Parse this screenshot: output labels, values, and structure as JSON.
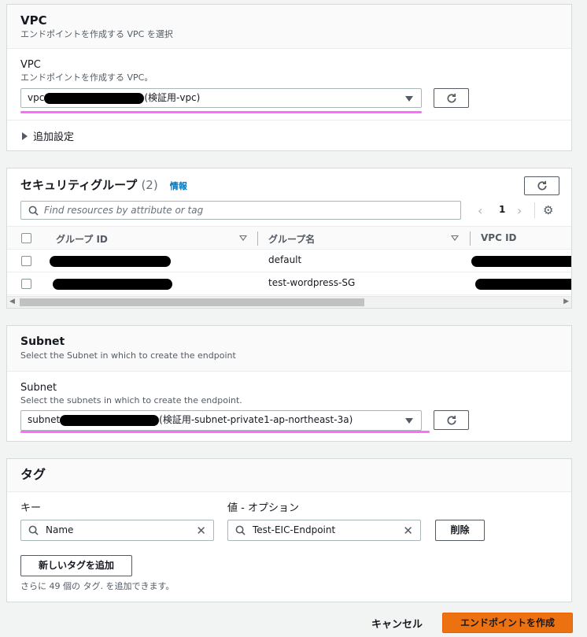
{
  "vpc_section": {
    "title": "VPC",
    "description": "エンドポイントを作成する VPC を選択",
    "field_label": "VPC",
    "field_desc": "エンドポイントを作成する VPC。",
    "select_prefix": "vpc",
    "select_suffix": "(検証用-vpc)",
    "additional_settings": "追加設定"
  },
  "sg_section": {
    "title": "セキュリティグループ",
    "count": "(2)",
    "info_link": "情報",
    "search_placeholder": "Find resources by attribute or tag",
    "page_number": "1",
    "columns": [
      "グループ ID",
      "グループ名",
      "VPC ID"
    ],
    "rows": [
      {
        "group_name": "default"
      },
      {
        "group_name": "test-wordpress-SG"
      }
    ]
  },
  "subnet_section": {
    "title": "Subnet",
    "description": "Select the Subnet in which to create the endpoint",
    "field_label": "Subnet",
    "field_desc": "Select the subnets in which to create the endpoint.",
    "select_prefix": "subnet",
    "select_suffix": "(検証用-subnet-private1-ap-northeast-3a)"
  },
  "tag_section": {
    "title": "タグ",
    "key_label": "キー",
    "value_label": "値 - オプション",
    "key_value": "Name",
    "value_value": "Test-EIC-Endpoint",
    "delete_button": "削除",
    "add_tag_button": "新しいタグを追加",
    "remaining_note": "さらに 49 個の タグ. を追加できます。"
  },
  "footer": {
    "cancel": "キャンセル",
    "create": "エンドポイントを作成"
  },
  "colors": {
    "primary": "#ec7211",
    "link": "#0073bb",
    "highlight": "#ff6bff"
  }
}
